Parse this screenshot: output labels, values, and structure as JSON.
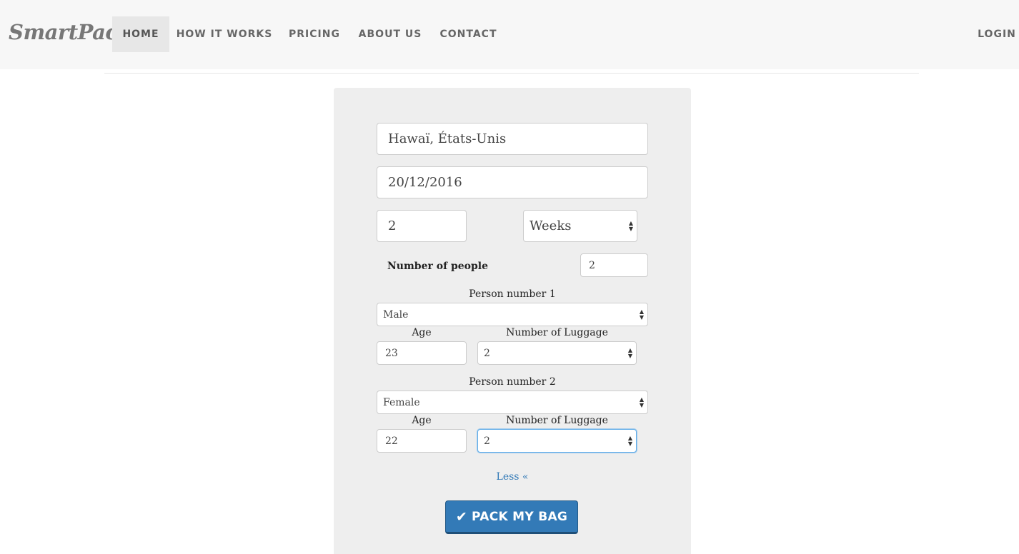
{
  "navbar": {
    "brand": "SmartPack",
    "items": [
      {
        "label": "HOME"
      },
      {
        "label": "HOW IT WORKS"
      },
      {
        "label": "PRICING"
      },
      {
        "label": "ABOUT US"
      },
      {
        "label": "CONTACT"
      }
    ],
    "login": "LOGIN"
  },
  "form": {
    "destination": "Hawaï, États-Unis",
    "date": "20/12/2016",
    "duration_value": "2",
    "duration_unit": "Weeks",
    "people_label": "Number of people",
    "people_count": "2",
    "persons": [
      {
        "title": "Person number 1",
        "gender": "Male",
        "age_label": "Age",
        "age": "23",
        "luggage_label": "Number of Luggage",
        "luggage": "2"
      },
      {
        "title": "Person number 2",
        "gender": "Female",
        "age_label": "Age",
        "age": "22",
        "luggage_label": "Number of Luggage",
        "luggage": "2"
      }
    ],
    "less_link": "Less «",
    "submit_label": "PACK MY BAG"
  },
  "colors": {
    "accent": "#337ab7",
    "navbar_bg": "#f7f7f7",
    "panel_bg": "#eeeeee"
  }
}
